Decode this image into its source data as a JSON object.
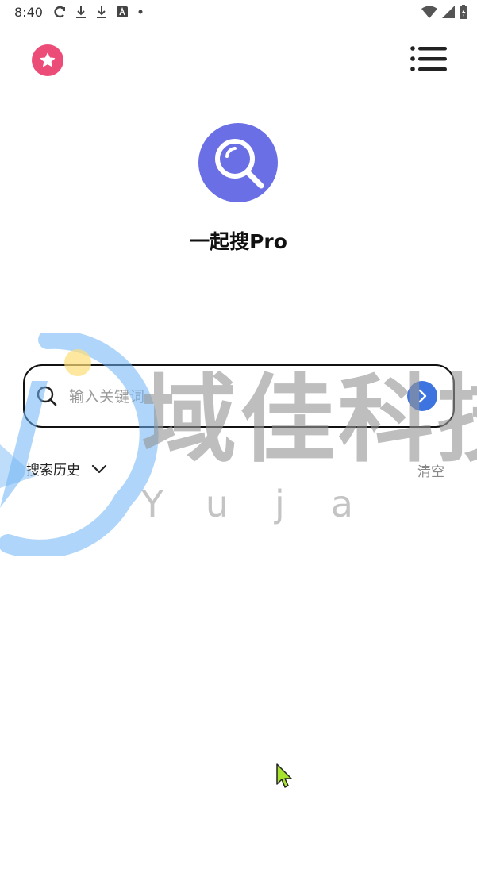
{
  "status_bar": {
    "time": "8:40",
    "icons": [
      "sync-icon",
      "download-icon",
      "download-icon",
      "font-icon",
      "dot-icon",
      "wifi-icon",
      "signal-icon",
      "battery-icon"
    ]
  },
  "header": {
    "favorite_icon": "star-icon",
    "menu_icon": "list-menu-icon"
  },
  "app": {
    "title": "一起搜Pro",
    "logo_icon": "magnifier-icon",
    "logo_color": "#6b6fe6"
  },
  "search": {
    "placeholder": "输入关键词",
    "value": "",
    "submit_icon": "chevron-right-icon",
    "accent": "#3d74e0"
  },
  "history": {
    "label": "搜索历史",
    "clear_label": "清空"
  },
  "watermark": {
    "text": "域佳科技",
    "subtext": "Yuja"
  },
  "colors": {
    "favorite": "#ec4d78"
  }
}
